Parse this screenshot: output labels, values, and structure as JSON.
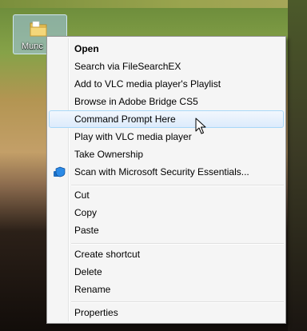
{
  "desktop": {
    "icon_label": "Munc",
    "icon": "folder-icon"
  },
  "context_menu": {
    "items": [
      {
        "label": "Open",
        "bold": true
      },
      {
        "label": "Search via FileSearchEX"
      },
      {
        "label": "Add to VLC media player's Playlist"
      },
      {
        "label": "Browse in Adobe Bridge CS5"
      },
      {
        "label": "Command Prompt Here",
        "highlighted": true
      },
      {
        "label": "Play with VLC media player"
      },
      {
        "label": "Take Ownership"
      },
      {
        "label": "Scan with Microsoft Security Essentials...",
        "icon": "shield-icon"
      },
      {
        "label": "Cut"
      },
      {
        "label": "Copy"
      },
      {
        "label": "Paste"
      },
      {
        "label": "Create shortcut"
      },
      {
        "label": "Delete"
      },
      {
        "label": "Rename"
      },
      {
        "label": "Properties"
      }
    ],
    "highlight_color": "#dcebfc",
    "highlight_border": "#a8d8f8"
  },
  "cursor": "arrow-cursor-icon"
}
